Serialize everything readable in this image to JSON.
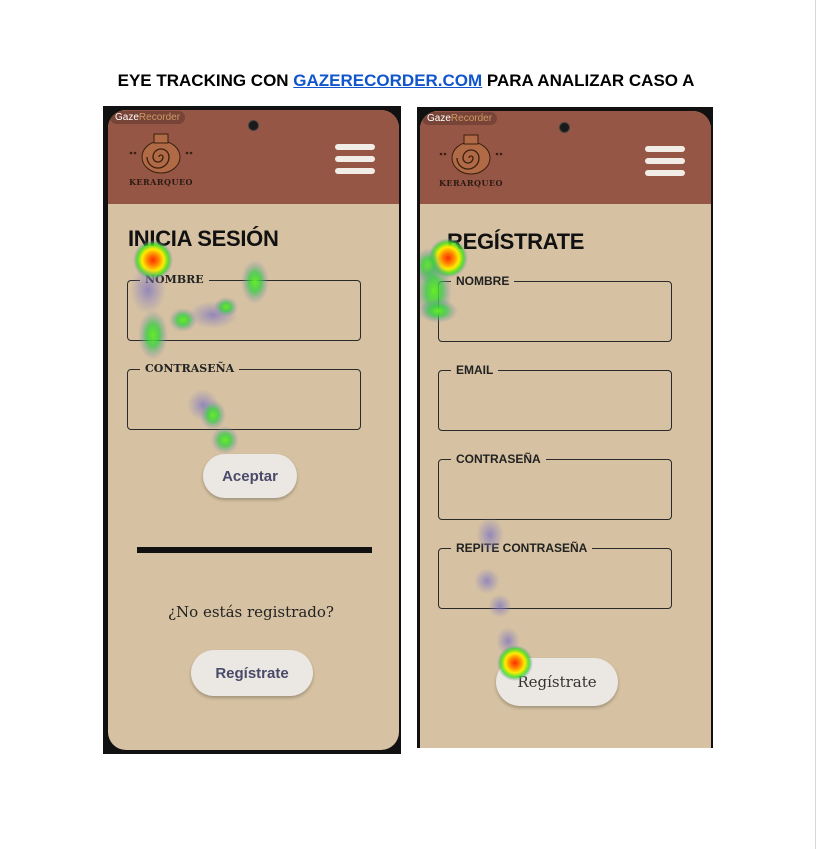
{
  "document": {
    "title_prefix": "EYE TRACKING CON ",
    "title_link": "GAZERECORDER.COM",
    "title_suffix": " PARA ANALIZAR CASO A"
  },
  "watermark": {
    "part1": "Gaze",
    "part2": "Recorder"
  },
  "brand": {
    "name": "KERARQUEO"
  },
  "login_screen": {
    "title": "INICIA SESIÓN",
    "fields": [
      "NOMBRE",
      "CONTRASEÑA"
    ],
    "accept_button": "Aceptar",
    "question": "¿No estás registrado?",
    "register_button": "Regístrate"
  },
  "register_screen": {
    "title": "REGÍSTRATE",
    "fields": [
      "NOMBRE",
      "EMAIL",
      "CONTRASEÑA",
      "REPITE CONTRASEÑA"
    ],
    "register_button": "Regístrate"
  },
  "colors": {
    "header": "#965645",
    "screen_bg": "#d6c2a2",
    "button_bg": "#ebe7e2",
    "link": "#1155cc",
    "heat_hot": "#ff2a00",
    "heat_mid": "#ffee00",
    "heat_cool": "#33dd22",
    "heat_low": "#8a7fc0"
  }
}
